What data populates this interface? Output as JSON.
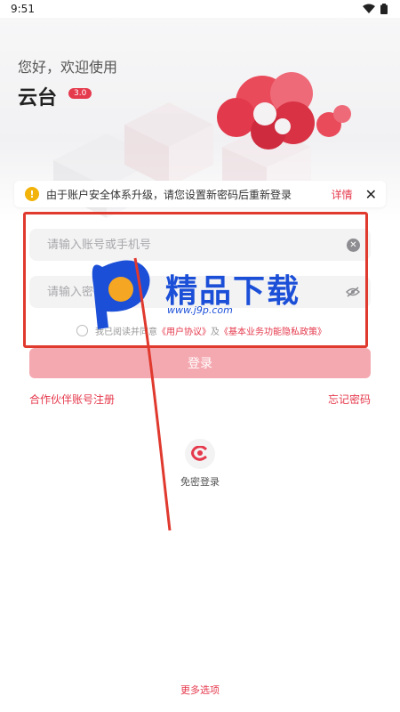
{
  "status_bar": {
    "time": "9:51"
  },
  "header": {
    "greeting": "您好，欢迎使用",
    "app_name": "云台",
    "version": "3.0"
  },
  "notice": {
    "text": "由于账户安全体系升级，请您设置新密码后重新登录",
    "detail": "详情",
    "close": "✕"
  },
  "form": {
    "account_placeholder": "请输入账号或手机号",
    "password_placeholder": "请输入密码",
    "agreement_prefix": "我已阅读并同意",
    "user_agreement": "《用户协议》",
    "agreement_joiner": "及",
    "privacy_policy": "《基本业务功能隐私政策》",
    "login_button": "登录"
  },
  "links": {
    "partner_register": "合作伙伴账号注册",
    "forgot_password": "忘记密码"
  },
  "passwordless": {
    "label": "免密登录"
  },
  "footer": {
    "more_options": "更多选项"
  },
  "watermark": {
    "title": "精品下载",
    "url": "www.j9p.com"
  },
  "colors": {
    "accent": "#e5394c",
    "login_button_disabled": "#f4a9b0",
    "field_background": "#f3f3f4",
    "annotation_frame": "#e0392e",
    "watermark_blue": "#1c4fd8"
  },
  "icons": {
    "wifi": "wifi-icon",
    "battery": "battery-icon",
    "warning": "warning-icon",
    "clear": "clear-icon",
    "visibility": "eye-off-icon",
    "passwordless": "brand-logo-icon"
  }
}
